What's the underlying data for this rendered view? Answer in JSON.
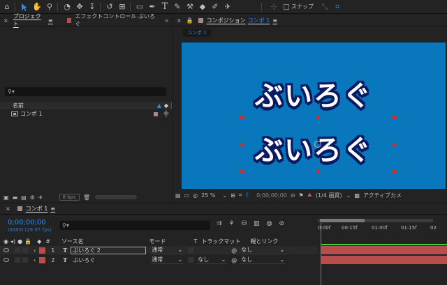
{
  "toolbar": {
    "snap_label": "スナップ",
    "icons": [
      "home-icon",
      "selection-tool-icon",
      "hand-tool-icon",
      "zoom-tool-icon",
      "orbit-camera-icon",
      "pan-camera-icon",
      "dolly-camera-icon",
      "rotate-tool-icon",
      "pan-behind-tool-icon",
      "rectangle-tool-icon",
      "pen-tool-icon",
      "type-tool-icon",
      "brush-tool-icon",
      "clone-stamp-icon",
      "eraser-tool-icon",
      "roto-brush-icon",
      "puppet-pin-icon"
    ]
  },
  "project_panel": {
    "tab_label": "プロジェクト",
    "effect_tab_label": "エフェクトコントロール ぶいろぐ",
    "col_name": "名前",
    "item_name": "コンポ 1",
    "bpc": "8 bpc"
  },
  "comp_panel": {
    "tab_prefix": "コンポジション",
    "tab_name": "コンポ 1",
    "subtab": "コンポ 1",
    "text_lines": [
      "ぶいろぐ",
      "ぶいろぐ"
    ],
    "zoom": "25 %",
    "timecode": "0;00;00;00",
    "resolution": "(1/4 画質)",
    "camera": "アクティブカメ",
    "bg_color": "#0977bc"
  },
  "timeline": {
    "tab_label": "コンポ 1",
    "timecode": "0;00;00;00",
    "frames": "00000 (29.97 fps)",
    "cols": {
      "num": "#",
      "source": "ソース名",
      "mode": "モード",
      "t": "T",
      "trkmat": "トラックマット",
      "parent": "親とリンク"
    },
    "layers": [
      {
        "num": "1",
        "type": "T",
        "name": "ぶいろぐ 2",
        "mode": "通常",
        "trkmat": "",
        "parent": "なし"
      },
      {
        "num": "2",
        "type": "T",
        "name": "ぶいろぐ",
        "mode": "通常",
        "trkmat": "なし",
        "parent": "なし"
      }
    ],
    "ruler": [
      "0:00f",
      "00:15f",
      "01:00f",
      "01:15f",
      "02"
    ]
  }
}
